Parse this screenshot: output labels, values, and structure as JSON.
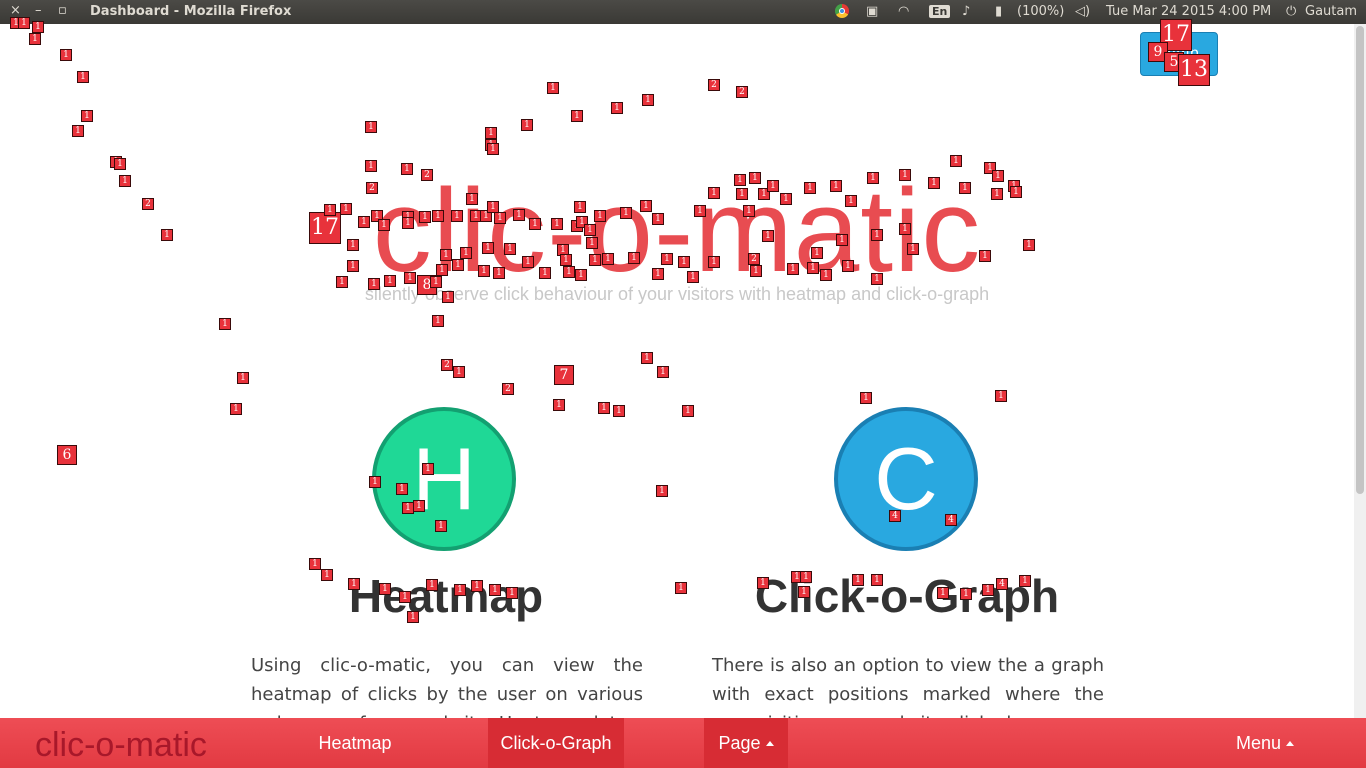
{
  "os_bar": {
    "window_title": "Dashboard - Mozilla Firefox",
    "close_glyph": "×",
    "minimize_glyph": "–",
    "maximize_glyph": "▫",
    "battery": "(100%)",
    "datetime": "Tue Mar 24 2015  4:00 PM",
    "user": "Gautam",
    "keyboard_layout": "En"
  },
  "hero": {
    "title": "clic-o-matic",
    "subtitle": "silently observe click behaviour of your visitors with heatmap and click-o-graph"
  },
  "top_button": {
    "label": "Login"
  },
  "features": [
    {
      "letter": "H",
      "title": "Heatmap",
      "text": "Using clic-o-matic, you can view the heatmap of clicks by the user on various webpages of your website. Heatmap data"
    },
    {
      "letter": "C",
      "title": "Click-o-Graph",
      "text": "There is also an option to view the a graph with exact positions marked where the user visiting your website clicked."
    }
  ],
  "navbar": {
    "brand": "clic-o-matic",
    "items": [
      "Heatmap",
      "Click-o-Graph",
      "Page",
      "Menu"
    ]
  },
  "colors": {
    "brand_red": "#e84c51",
    "heatmap_green": "#1fd896",
    "graph_blue": "#29a8e0",
    "marker_red": "#e8323b"
  },
  "click_markers": [
    [
      16,
      23,
      "1"
    ],
    [
      24,
      23,
      "1"
    ],
    [
      38,
      27,
      "1"
    ],
    [
      35,
      39,
      "1"
    ],
    [
      66,
      55,
      "1"
    ],
    [
      83,
      77,
      "1"
    ],
    [
      87,
      116,
      "1"
    ],
    [
      78,
      131,
      "1"
    ],
    [
      116,
      162,
      "1"
    ],
    [
      120,
      164,
      "1"
    ],
    [
      125,
      181,
      "1"
    ],
    [
      148,
      204,
      "2"
    ],
    [
      167,
      235,
      "1"
    ],
    [
      225,
      324,
      "1"
    ],
    [
      243,
      378,
      "1"
    ],
    [
      236,
      409,
      "1"
    ],
    [
      67,
      455,
      "6"
    ],
    [
      371,
      127,
      "1"
    ],
    [
      371,
      166,
      "1"
    ],
    [
      372,
      188,
      "2"
    ],
    [
      407,
      169,
      "1"
    ],
    [
      427,
      175,
      "2"
    ],
    [
      553,
      88,
      "1"
    ],
    [
      714,
      85,
      "2"
    ],
    [
      742,
      92,
      "2"
    ],
    [
      527,
      125,
      "1"
    ],
    [
      577,
      116,
      "1"
    ],
    [
      617,
      108,
      "1"
    ],
    [
      648,
      100,
      "1"
    ],
    [
      491,
      133,
      "1"
    ],
    [
      491,
      145,
      "1"
    ],
    [
      493,
      149,
      "1"
    ],
    [
      325,
      228,
      "17"
    ],
    [
      330,
      210,
      "1"
    ],
    [
      346,
      209,
      "1"
    ],
    [
      364,
      222,
      "1"
    ],
    [
      377,
      216,
      "1"
    ],
    [
      384,
      225,
      "1"
    ],
    [
      353,
      245,
      "1"
    ],
    [
      353,
      266,
      "1"
    ],
    [
      342,
      282,
      "1"
    ],
    [
      374,
      284,
      "1"
    ],
    [
      390,
      281,
      "1"
    ],
    [
      410,
      278,
      "1"
    ],
    [
      408,
      217,
      "1"
    ],
    [
      408,
      223,
      "1"
    ],
    [
      425,
      217,
      "1"
    ],
    [
      438,
      216,
      "1"
    ],
    [
      457,
      216,
      "1"
    ],
    [
      476,
      216,
      "1"
    ],
    [
      472,
      199,
      "1"
    ],
    [
      486,
      216,
      "1"
    ],
    [
      493,
      207,
      "1"
    ],
    [
      500,
      218,
      "1"
    ],
    [
      519,
      215,
      "1"
    ],
    [
      535,
      224,
      "1"
    ],
    [
      557,
      224,
      "1"
    ],
    [
      580,
      207,
      "1"
    ],
    [
      577,
      226,
      "1"
    ],
    [
      582,
      222,
      "1"
    ],
    [
      590,
      230,
      "1"
    ],
    [
      600,
      216,
      "1"
    ],
    [
      626,
      213,
      "1"
    ],
    [
      646,
      206,
      "1"
    ],
    [
      658,
      219,
      "1"
    ],
    [
      592,
      243,
      "1"
    ],
    [
      563,
      250,
      "1"
    ],
    [
      510,
      249,
      "1"
    ],
    [
      488,
      248,
      "1"
    ],
    [
      466,
      253,
      "1"
    ],
    [
      446,
      255,
      "1"
    ],
    [
      458,
      265,
      "1"
    ],
    [
      442,
      270,
      "1"
    ],
    [
      427,
      285,
      "8"
    ],
    [
      436,
      282,
      "1"
    ],
    [
      448,
      297,
      "1"
    ],
    [
      438,
      321,
      "1"
    ],
    [
      484,
      271,
      "1"
    ],
    [
      499,
      273,
      "1"
    ],
    [
      528,
      262,
      "1"
    ],
    [
      545,
      273,
      "1"
    ],
    [
      566,
      260,
      "1"
    ],
    [
      569,
      272,
      "1"
    ],
    [
      581,
      275,
      "1"
    ],
    [
      595,
      260,
      "1"
    ],
    [
      608,
      259,
      "1"
    ],
    [
      634,
      258,
      "1"
    ],
    [
      658,
      274,
      "1"
    ],
    [
      667,
      259,
      "1"
    ],
    [
      684,
      262,
      "1"
    ],
    [
      693,
      277,
      "1"
    ],
    [
      714,
      262,
      "1"
    ],
    [
      754,
      259,
      "2"
    ],
    [
      756,
      271,
      "1"
    ],
    [
      768,
      236,
      "1"
    ],
    [
      793,
      269,
      "1"
    ],
    [
      813,
      268,
      "1"
    ],
    [
      817,
      253,
      "1"
    ],
    [
      826,
      275,
      "1"
    ],
    [
      842,
      240,
      "1"
    ],
    [
      848,
      266,
      "1"
    ],
    [
      877,
      279,
      "1"
    ],
    [
      877,
      235,
      "1"
    ],
    [
      905,
      229,
      "1"
    ],
    [
      913,
      249,
      "1"
    ],
    [
      985,
      256,
      "1"
    ],
    [
      1029,
      245,
      "1"
    ],
    [
      700,
      211,
      "1"
    ],
    [
      714,
      193,
      "1"
    ],
    [
      740,
      180,
      "1"
    ],
    [
      742,
      194,
      "1"
    ],
    [
      755,
      178,
      "1"
    ],
    [
      749,
      211,
      "1"
    ],
    [
      764,
      194,
      "1"
    ],
    [
      773,
      186,
      "1"
    ],
    [
      786,
      199,
      "1"
    ],
    [
      810,
      188,
      "1"
    ],
    [
      836,
      186,
      "1"
    ],
    [
      851,
      201,
      "1"
    ],
    [
      873,
      178,
      "1"
    ],
    [
      905,
      175,
      "1"
    ],
    [
      934,
      183,
      "1"
    ],
    [
      956,
      161,
      "1"
    ],
    [
      965,
      188,
      "1"
    ],
    [
      990,
      168,
      "1"
    ],
    [
      998,
      176,
      "1"
    ],
    [
      997,
      194,
      "1"
    ],
    [
      1014,
      186,
      "1"
    ],
    [
      1016,
      192,
      "1"
    ],
    [
      447,
      365,
      "2"
    ],
    [
      459,
      372,
      "1"
    ],
    [
      508,
      389,
      "2"
    ],
    [
      564,
      375,
      "7"
    ],
    [
      647,
      358,
      "1"
    ],
    [
      663,
      372,
      "1"
    ],
    [
      559,
      405,
      "1"
    ],
    [
      604,
      408,
      "1"
    ],
    [
      619,
      411,
      "1"
    ],
    [
      688,
      411,
      "1"
    ],
    [
      662,
      491,
      "1"
    ],
    [
      866,
      398,
      "1"
    ],
    [
      1001,
      396,
      "1"
    ],
    [
      428,
      469,
      "1"
    ],
    [
      375,
      482,
      "1"
    ],
    [
      402,
      489,
      "1"
    ],
    [
      408,
      508,
      "1"
    ],
    [
      419,
      506,
      "1"
    ],
    [
      441,
      526,
      "1"
    ],
    [
      895,
      516,
      "4"
    ],
    [
      951,
      520,
      "4"
    ],
    [
      315,
      564,
      "1"
    ],
    [
      327,
      575,
      "1"
    ],
    [
      354,
      584,
      "1"
    ],
    [
      385,
      589,
      "1"
    ],
    [
      405,
      597,
      "1"
    ],
    [
      413,
      617,
      "1"
    ],
    [
      432,
      585,
      "1"
    ],
    [
      460,
      590,
      "1"
    ],
    [
      477,
      586,
      "1"
    ],
    [
      495,
      590,
      "1"
    ],
    [
      512,
      593,
      "1"
    ],
    [
      681,
      588,
      "1"
    ],
    [
      763,
      583,
      "1"
    ],
    [
      797,
      577,
      "1"
    ],
    [
      806,
      577,
      "1"
    ],
    [
      804,
      592,
      "1"
    ],
    [
      858,
      580,
      "1"
    ],
    [
      877,
      580,
      "1"
    ],
    [
      943,
      593,
      "1"
    ],
    [
      966,
      594,
      "1"
    ],
    [
      988,
      590,
      "1"
    ],
    [
      1002,
      584,
      "4"
    ],
    [
      1025,
      581,
      "1"
    ],
    [
      1176,
      35,
      "17"
    ],
    [
      1158,
      52,
      "9"
    ],
    [
      1174,
      62,
      "5"
    ],
    [
      1194,
      70,
      "13"
    ]
  ]
}
